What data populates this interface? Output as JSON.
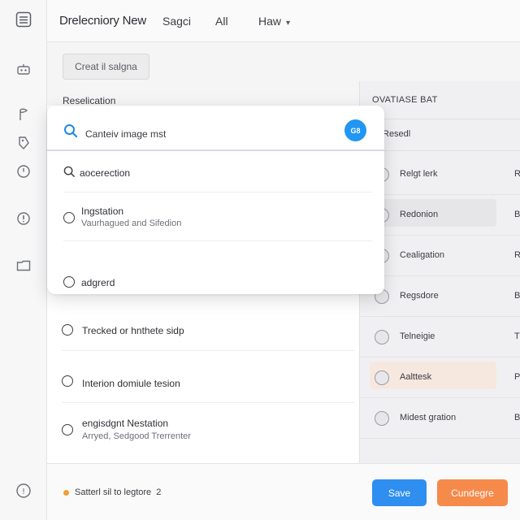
{
  "header": {
    "title": "Drelecniory New",
    "nav": [
      "Sagci",
      "All",
      "Haw"
    ]
  },
  "toolbar": {
    "create_label": "Creat il salgna"
  },
  "section": {
    "label": "Reselication"
  },
  "search": {
    "value": "Canteiv image mst",
    "ai_label": "G8"
  },
  "popup_options": [
    {
      "title": "aocerection",
      "subtitle": ""
    },
    {
      "title": "Ingstation",
      "subtitle": "Vaurhagued and Sifedion"
    },
    {
      "title": "adgrerd",
      "subtitle": ""
    }
  ],
  "list_items": [
    {
      "title": "Trecked or hnthete sidp",
      "subtitle": ""
    },
    {
      "title": "Interion domiule tesion",
      "subtitle": ""
    },
    {
      "title": "engisdgnt Nestation",
      "subtitle": "Arryed, Sedgood Trerrenter"
    }
  ],
  "panel": {
    "title": "OVATIASE BAT",
    "subtitle": "Resedl",
    "items": [
      {
        "label": "Relgt lerk",
        "edge": "R",
        "highlight": ""
      },
      {
        "label": "Redonion",
        "edge": "B",
        "highlight": "#e6e6e9"
      },
      {
        "label": "Cealigation",
        "edge": "R",
        "highlight": ""
      },
      {
        "label": "Regsdore",
        "edge": "B",
        "highlight": ""
      },
      {
        "label": "Telneigie",
        "edge": "T",
        "highlight": ""
      },
      {
        "label": "Aalttesk",
        "edge": "P",
        "highlight": "#f6e8df"
      },
      {
        "label": "Midest gration",
        "edge": "B",
        "highlight": ""
      }
    ]
  },
  "footer": {
    "status": "Satterl sil to legtore",
    "count": "2",
    "save_label": "Save",
    "cancel_label": "Cundegre"
  },
  "colors": {
    "primary": "#2e8ff0",
    "accent": "#f58a4b",
    "status_dot": "#f0a035"
  },
  "icons": [
    "menu-icon",
    "robot-icon",
    "flag-icon",
    "tag-icon",
    "clock-icon",
    "info-icon",
    "folder-icon",
    "help-icon",
    "search-icon"
  ]
}
